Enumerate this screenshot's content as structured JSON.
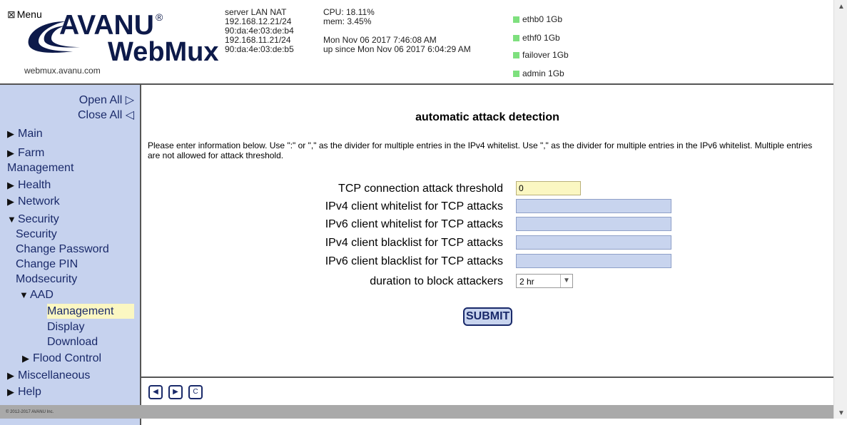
{
  "header": {
    "menu_label": "Menu",
    "menu_icon": "checkbox-x-icon",
    "logo": {
      "brand": "AVANU",
      "reg": "®",
      "product": "WebMux",
      "url": "webmux.avanu.com"
    },
    "network_info": "server LAN NAT\n192.168.12.21/24\n90:da:4e:03:de:b4\n192.168.11.21/24\n90:da:4e:03:de:b5",
    "system_info": "CPU: 18.11%\nmem: 3.45%\n\nMon Nov 06 2017 7:46:08 AM\nup since Mon Nov 06 2017 6:04:29 AM",
    "interfaces": [
      {
        "name": "ethb0",
        "speed": "1Gb",
        "label": "ethb0  1Gb"
      },
      {
        "name": "ethf0",
        "speed": "1Gb",
        "label": "ethf0   1Gb"
      },
      {
        "name": "failover",
        "speed": "1Gb",
        "label": "failover 1Gb"
      },
      {
        "name": "admin",
        "speed": "1Gb",
        "label": "admin  1Gb"
      }
    ],
    "status_color": "#7ee07e"
  },
  "sidebar": {
    "open_all": "Open All ▷",
    "close_all": "Close All ◁",
    "items": {
      "main": "Main",
      "farm": "Farm",
      "management": "Management",
      "health": "Health",
      "network": "Network",
      "security": "Security",
      "security_sub": "Security",
      "change_password": "Change Password",
      "change_pin": "Change PIN",
      "modsecurity": "Modsecurity",
      "aad": "AAD",
      "aad_management": "Management",
      "aad_display": "Display",
      "aad_download": "Download",
      "flood_control": "Flood Control",
      "miscellaneous": "Miscellaneous",
      "help": "Help"
    },
    "colors": {
      "background": "#c6d2ee",
      "active": "#fbf7c2"
    }
  },
  "main": {
    "title": "automatic attack detection",
    "description": "Please enter information below. Use \":\" or \",\" as the divider for multiple entries in the IPv4 whitelist. Use \",\" as the divider for multiple entries in the IPv6 whitelist. Multiple entries are not allowed for attack threshold.",
    "fields": {
      "threshold_label": "TCP connection attack threshold",
      "threshold_value": "0",
      "ipv4_whitelist_label": "IPv4 client whitelist for TCP attacks",
      "ipv4_whitelist_value": "",
      "ipv6_whitelist_label": "IPv6 client whitelist for TCP attacks",
      "ipv6_whitelist_value": "",
      "ipv4_blacklist_label": "IPv4 client blacklist for TCP attacks",
      "ipv4_blacklist_value": "",
      "ipv6_blacklist_label": "IPv6 client blacklist for TCP attacks",
      "ipv6_blacklist_value": "",
      "duration_label": "duration to block attackers",
      "duration_value": "2 hr"
    },
    "submit_label": "SUBMIT"
  },
  "bottom_bar": {
    "back_icon": "back-arrow-icon",
    "forward_icon": "forward-arrow-icon",
    "refresh_icon": "refresh-icon",
    "back_glyph": "◀",
    "forward_glyph": "▶",
    "refresh_glyph": "C"
  },
  "footer": {
    "copyright": "© 2012-2017 AVANU Inc."
  }
}
